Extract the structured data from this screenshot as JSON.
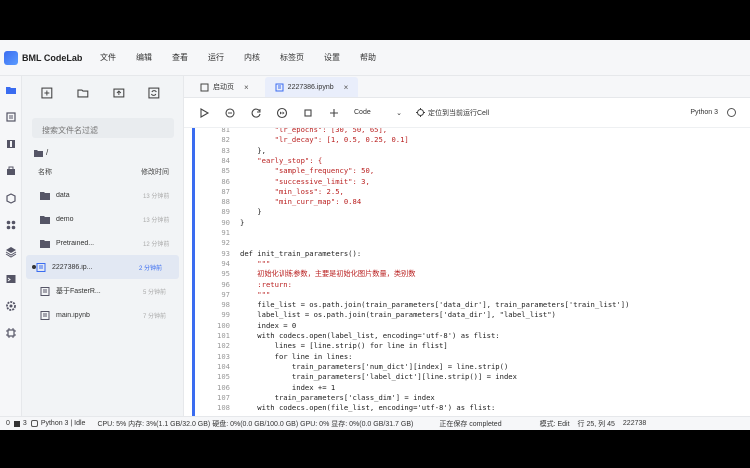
{
  "app": {
    "title": "BML CodeLab"
  },
  "menu": [
    "文件",
    "编辑",
    "查看",
    "运行",
    "内核",
    "标签页",
    "设置",
    "帮助"
  ],
  "filepanel": {
    "filter_placeholder": "搜索文件名过滤",
    "breadcrumb": "/",
    "col_name": "名称",
    "col_modified": "修改时间",
    "files": [
      {
        "name": "data",
        "time": "13 分钟前",
        "type": "folder"
      },
      {
        "name": "demo",
        "time": "13 分钟前",
        "type": "folder"
      },
      {
        "name": "Pretrained...",
        "time": "12 分钟前",
        "type": "folder"
      },
      {
        "name": "2227386.ip...",
        "time": "2 分钟前",
        "type": "notebook",
        "selected": true
      },
      {
        "name": "基于FasterR...",
        "time": "5 分钟前",
        "type": "notebook"
      },
      {
        "name": "main.ipynb",
        "time": "7 分钟前",
        "type": "notebook"
      }
    ]
  },
  "tabs": [
    {
      "label": "启动页"
    },
    {
      "label": "2227386.ipynb"
    }
  ],
  "toolbar": {
    "cell_type": "Code",
    "locate": "定位到当前运行Cell",
    "kernel": "Python 3"
  },
  "code_lines": [
    {
      "n": "81",
      "t": "        \"lr_epochs\": [30, 50, 65],"
    },
    {
      "n": "82",
      "t": "        \"lr_decay\": [1, 0.5, 0.25, 0.1]"
    },
    {
      "n": "83",
      "t": "    },"
    },
    {
      "n": "84",
      "t": "    \"early_stop\": {"
    },
    {
      "n": "85",
      "t": "        \"sample_frequency\": 50,"
    },
    {
      "n": "86",
      "t": "        \"successive_limit\": 3,"
    },
    {
      "n": "87",
      "t": "        \"min_loss\": 2.5,"
    },
    {
      "n": "88",
      "t": "        \"min_curr_map\": 0.84"
    },
    {
      "n": "89",
      "t": "    }"
    },
    {
      "n": "90",
      "t": "}"
    },
    {
      "n": "91",
      "t": ""
    },
    {
      "n": "92",
      "t": ""
    },
    {
      "n": "93",
      "t": "def init_train_parameters():"
    },
    {
      "n": "94",
      "t": "    \"\"\""
    },
    {
      "n": "95",
      "t": "    初始化训练参数，主要是初始化图片数量，类别数"
    },
    {
      "n": "96",
      "t": "    :return:"
    },
    {
      "n": "97",
      "t": "    \"\"\""
    },
    {
      "n": "98",
      "t": "    file_list = os.path.join(train_parameters['data_dir'], train_parameters['train_list'])"
    },
    {
      "n": "99",
      "t": "    label_list = os.path.join(train_parameters['data_dir'], \"label_list\")"
    },
    {
      "n": "100",
      "t": "    index = 0"
    },
    {
      "n": "101",
      "t": "    with codecs.open(label_list, encoding='utf-8') as flist:"
    },
    {
      "n": "102",
      "t": "        lines = [line.strip() for line in flist]"
    },
    {
      "n": "103",
      "t": "        for line in lines:"
    },
    {
      "n": "104",
      "t": "            train_parameters['num_dict'][index] = line.strip()"
    },
    {
      "n": "105",
      "t": "            train_parameters['label_dict'][line.strip()] = index"
    },
    {
      "n": "106",
      "t": "            index += 1"
    },
    {
      "n": "107",
      "t": "        train_parameters['class_dim'] = index"
    },
    {
      "n": "108",
      "t": "    with codecs.open(file_list, encoding='utf-8') as flist:"
    }
  ],
  "status": {
    "left": "0",
    "count": "3",
    "kernel": "Python 3 | Idle",
    "resources": "CPU: 5% 内存: 3%(1.1 GB/32.0 GB) 硬盘: 0%(0.0 GB/100.0 GB) GPU: 0% 显存: 0%(0.0 GB/31.7 GB)",
    "saving": "正在保存 completed",
    "mode": "模式: Edit",
    "position": "行 25, 列 45",
    "file": "222738"
  },
  "colors": {
    "accent": "#3a6cf0"
  }
}
